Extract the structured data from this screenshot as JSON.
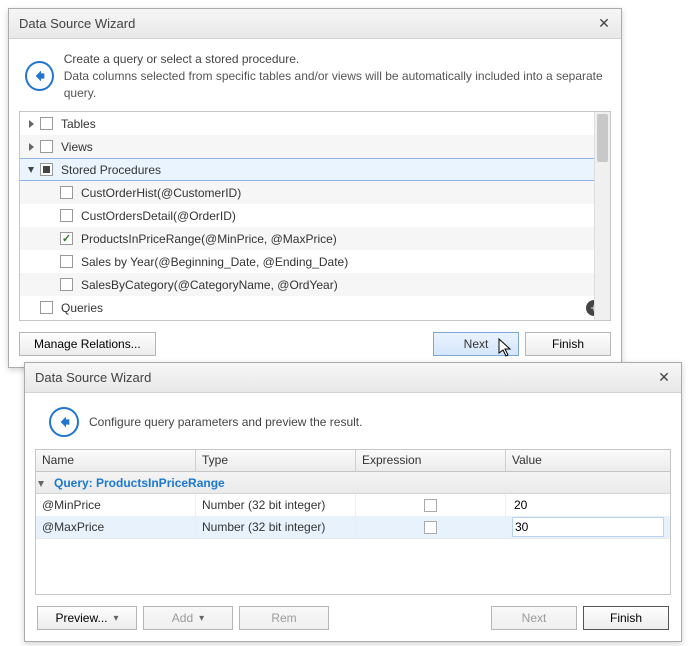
{
  "dialog1": {
    "title": "Data Source Wizard",
    "description_line1": "Create a query or select a stored procedure.",
    "description_line2": "Data columns selected from specific tables and/or views will be automatically included into a separate query.",
    "tree": {
      "tables": "Tables",
      "views": "Views",
      "stored_procedures": "Stored Procedures",
      "sp_items": [
        "CustOrderHist(@CustomerID)",
        "CustOrdersDetail(@OrderID)",
        "ProductsInPriceRange(@MinPrice, @MaxPrice)",
        "Sales by Year(@Beginning_Date, @Ending_Date)",
        "SalesByCategory(@CategoryName, @OrdYear)"
      ],
      "queries": "Queries"
    },
    "buttons": {
      "manage_relations": "Manage Relations...",
      "next": "Next",
      "finish": "Finish"
    }
  },
  "dialog2": {
    "title": "Data Source Wizard",
    "description": "Configure query parameters and preview the result.",
    "grid": {
      "headers": {
        "name": "Name",
        "type": "Type",
        "expression": "Expression",
        "value": "Value"
      },
      "query_label": "Query: ProductsInPriceRange",
      "rows": [
        {
          "name": "@MinPrice",
          "type": "Number (32 bit integer)",
          "value": "20"
        },
        {
          "name": "@MaxPrice",
          "type": "Number (32 bit integer)",
          "value": "30"
        }
      ]
    },
    "buttons": {
      "preview": "Preview...",
      "add": "Add",
      "rem": "Rem",
      "next": "Next",
      "finish": "Finish"
    }
  }
}
